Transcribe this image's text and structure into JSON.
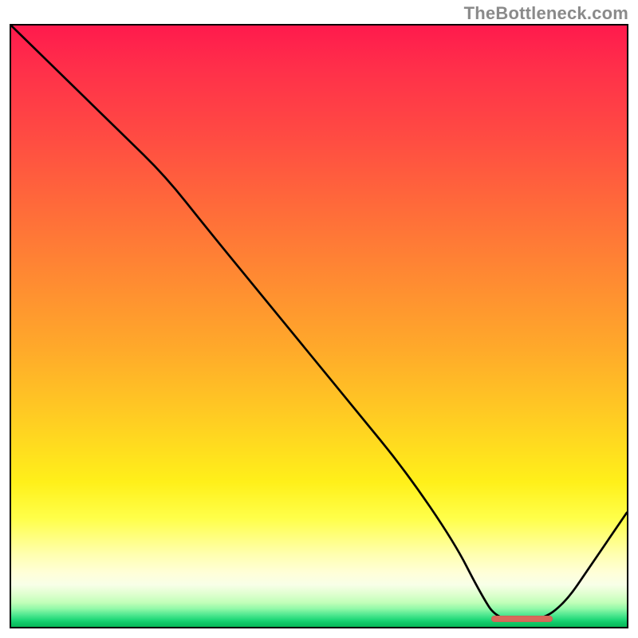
{
  "watermark": "TheBottleneck.com",
  "chart_data": {
    "type": "line",
    "title": "",
    "xlabel": "",
    "ylabel": "",
    "xlim": [
      0,
      100
    ],
    "ylim": [
      0,
      100
    ],
    "series": [
      {
        "name": "bottleneck-curve",
        "x": [
          0,
          8,
          18,
          25,
          32,
          40,
          48,
          56,
          64,
          72,
          76,
          79,
          86,
          90,
          94,
          100
        ],
        "y": [
          100,
          92,
          82,
          75,
          66,
          56,
          46,
          36,
          26,
          14,
          6,
          1,
          1,
          4,
          10,
          19
        ]
      }
    ],
    "annotations": [
      {
        "name": "optimal-range-marker",
        "x_start": 78,
        "x_end": 88,
        "y": 1,
        "color": "#d86a5a"
      }
    ],
    "gradient_stops": [
      {
        "pos": 0.0,
        "color": "#ff1a4d"
      },
      {
        "pos": 0.3,
        "color": "#ff6a3a"
      },
      {
        "pos": 0.66,
        "color": "#ffcf22"
      },
      {
        "pos": 0.88,
        "color": "#ffffb0"
      },
      {
        "pos": 0.97,
        "color": "#50e890"
      },
      {
        "pos": 1.0,
        "color": "#08b858"
      }
    ]
  }
}
